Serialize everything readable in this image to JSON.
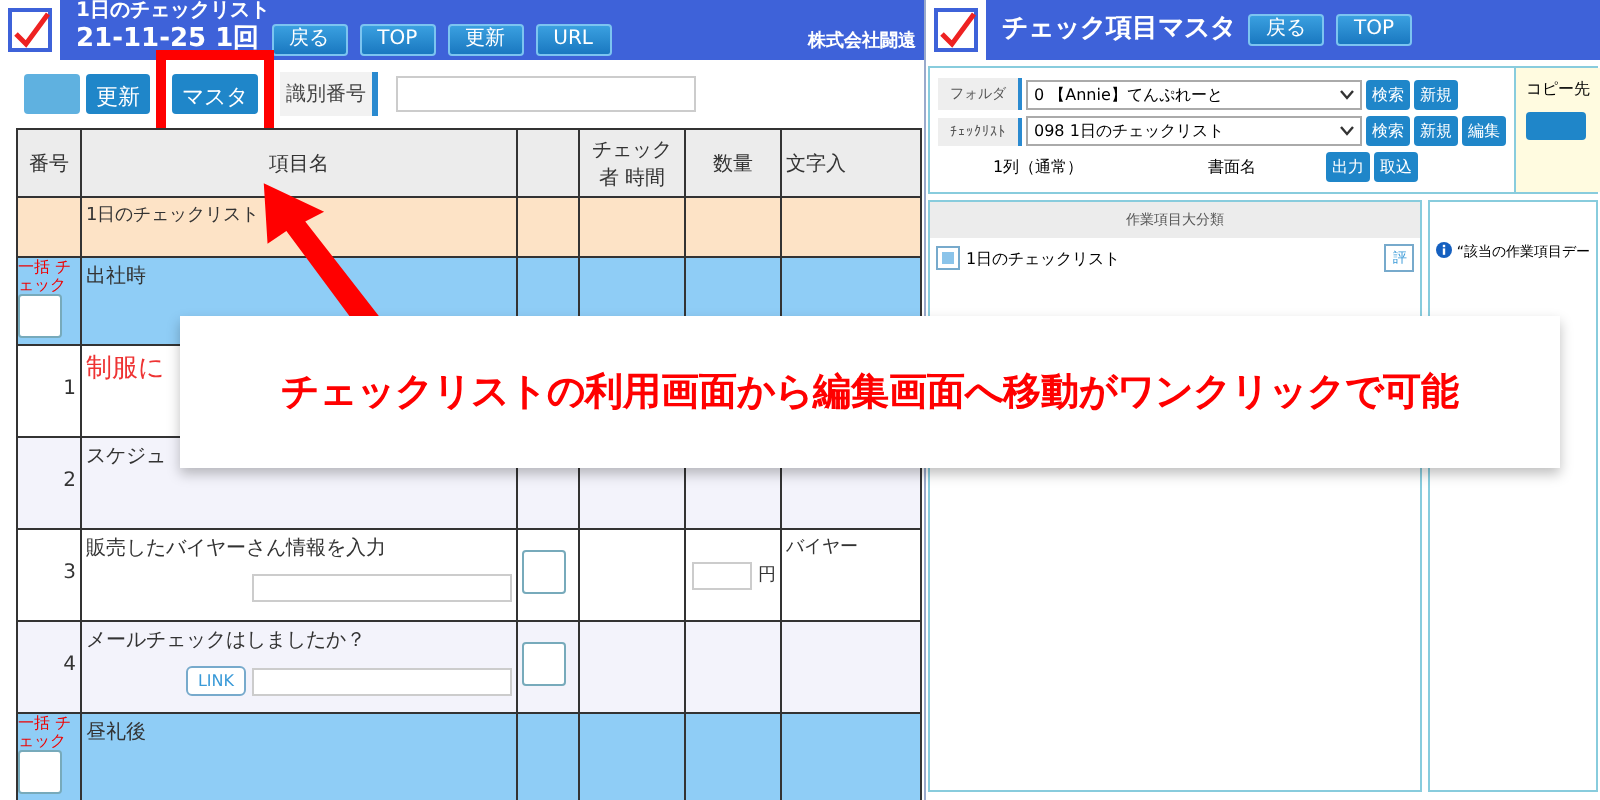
{
  "main": {
    "title": "1日のチェックリスト",
    "subtitle": "21-11-25 1回",
    "nav_buttons": [
      "戻る",
      "TOP",
      "更新",
      "URL"
    ],
    "company": "株式会社闘遠",
    "toolbar": {
      "buttons": [
        "更新",
        "マスタ"
      ],
      "id_label": "識別番号"
    },
    "columns": [
      {
        "kind": "text",
        "label": "番号"
      },
      {
        "kind": "text",
        "label": "項目名"
      },
      {
        "kind": "check"
      },
      {
        "kind": "text",
        "label": "チェック者 時間"
      },
      {
        "kind": "text",
        "label": "数量"
      },
      {
        "kind": "text",
        "label": "文字入"
      }
    ],
    "rows": [
      {
        "kind": "section",
        "title": "1日のチェックリスト"
      },
      {
        "kind": "group",
        "bulk_label": "一括 チェック",
        "title": "出社時",
        "checked": false
      },
      {
        "kind": "item",
        "number": "1",
        "title": "制服に",
        "alert": true
      },
      {
        "kind": "item",
        "number": "2",
        "title": "スケジュ",
        "alert": false
      },
      {
        "kind": "item",
        "number": "3",
        "title": "販売したバイヤーさん情報を入力",
        "alert": false,
        "checked": false,
        "unit": "円",
        "text_label": "バイヤー"
      },
      {
        "kind": "item",
        "number": "4",
        "title": "メールチェックはしましたか？",
        "alert": false,
        "checked": false,
        "link": "LINK"
      },
      {
        "kind": "group",
        "bulk_label": "一括 チェック",
        "title": "昼礼後",
        "checked": false
      }
    ]
  },
  "master": {
    "title": "チェック項目マスタ",
    "nav_buttons": [
      "戻る",
      "TOP"
    ],
    "fields": [
      {
        "label": "フォルダ",
        "value": "0 【Annie】てんぷれーと",
        "buttons": [
          "検索",
          "新規"
        ]
      },
      {
        "label": "ﾁｪｯｸﾘｽﾄ",
        "value": "098 1日のチェックリスト",
        "buttons": [
          "検索",
          "新規",
          "編集"
        ]
      }
    ],
    "info_row": {
      "column_mode": "1列（通常）",
      "doc_label": "書面名",
      "buttons": [
        "出力",
        "取込"
      ]
    },
    "copy_label": "コピー先",
    "category_header": "作業項目大分類",
    "category_item": "1日のチェックリスト",
    "category_button": "評",
    "notice": "“該当の作業項目デー"
  },
  "banner": "チェックリストの利用画面から編集画面へ移動がワンクリックで可能"
}
